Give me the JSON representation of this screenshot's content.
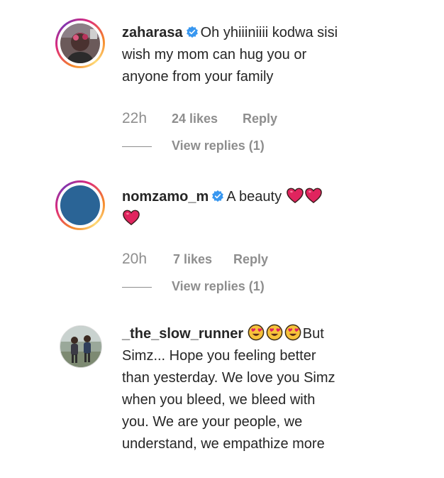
{
  "comments": [
    {
      "username": "zaharasa",
      "verified": true,
      "text_lines": [
        "Oh yhiiiniiii kodwa sisi",
        "wish my mom can hug you or",
        "anyone from your family"
      ],
      "time": "22h",
      "likes": "24 likes",
      "reply": "Reply",
      "view_replies": "View replies (1)",
      "avatar_icon": "profile-photo-avatar"
    },
    {
      "username": "nomzamo_m",
      "verified": true,
      "text": "A beauty",
      "emojis": [
        "red-heart-icon",
        "red-heart-icon",
        "red-heart-icon"
      ],
      "time": "20h",
      "likes": "7 likes",
      "reply": "Reply",
      "view_replies": "View replies (1)",
      "avatar_color": "#2a6496"
    },
    {
      "username": "_the_slow_runner",
      "verified": false,
      "emojis": [
        "heart-eyes-icon",
        "heart-eyes-icon",
        "heart-eyes-icon"
      ],
      "text_first": "But",
      "text_lines": [
        "Simz... Hope you feeling better",
        "than yesterday. We love you Simz",
        "when you bleed, we bleed with",
        "you. We are your people, we",
        "understand, we empathize more"
      ],
      "avatar_icon": "profile-photo-avatar"
    }
  ],
  "colors": {
    "text": "#262626",
    "secondary": "#8e8e8e",
    "verified_blue": "#3897f0",
    "heart_red": "#e0245e"
  }
}
